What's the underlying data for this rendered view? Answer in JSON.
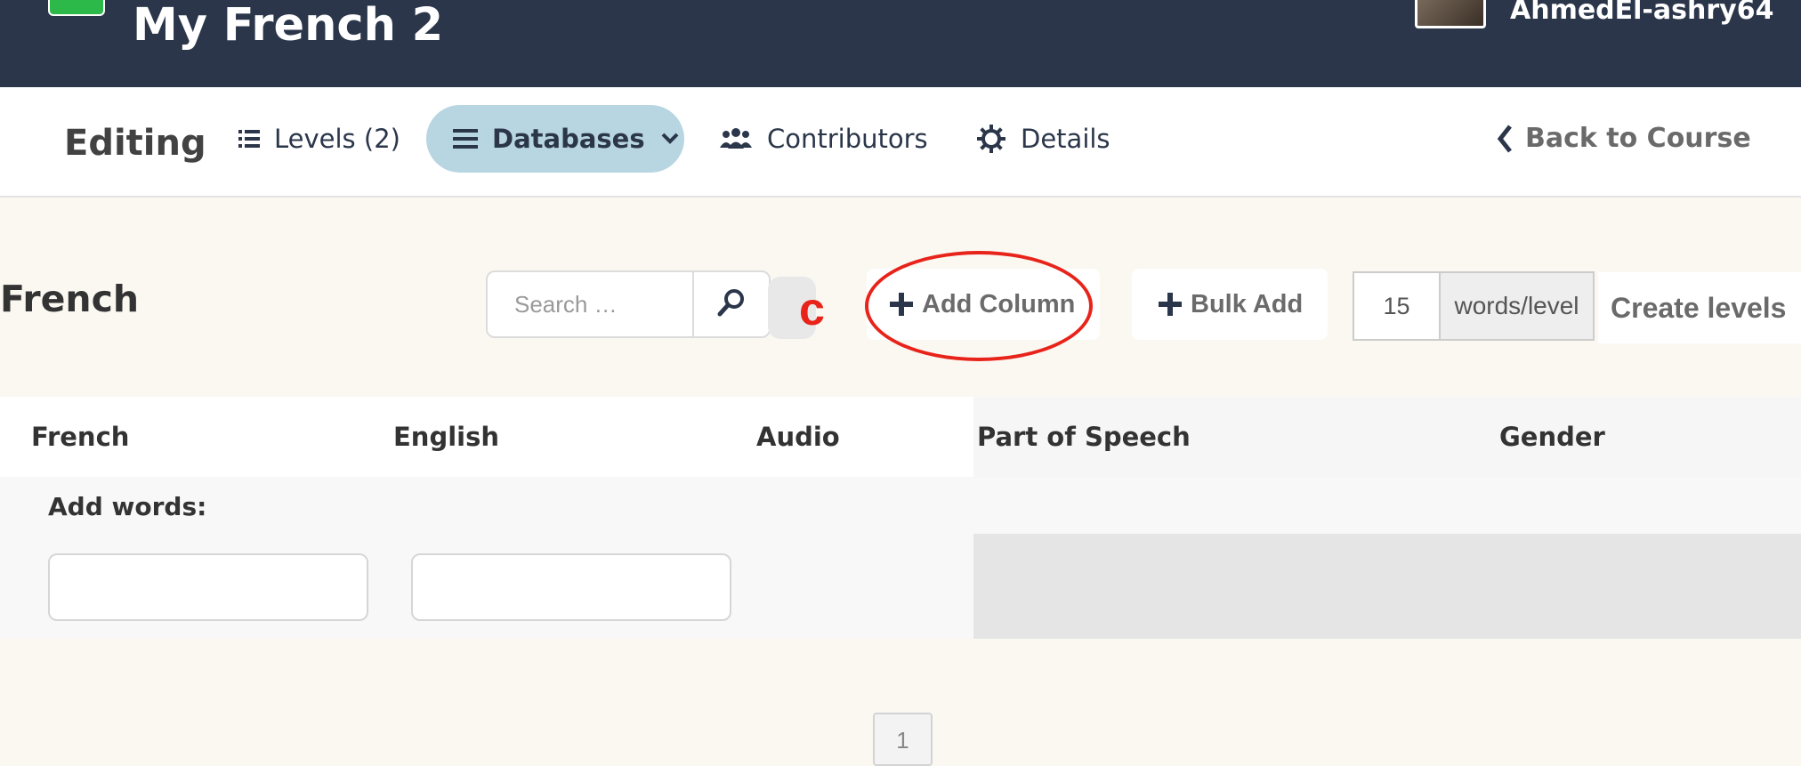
{
  "header": {
    "course_title": "My French 2",
    "username": "AhmedEl-ashry64"
  },
  "editbar": {
    "editing_label": "Editing",
    "nav": {
      "levels": "Levels (2)",
      "databases": "Databases",
      "contributors": "Contributors",
      "details": "Details"
    },
    "back_label": "Back to Course"
  },
  "database": {
    "title": "French",
    "search_placeholder": "Search …",
    "annotation_letter": "c",
    "add_column_label": "Add Column",
    "bulk_add_label": "Bulk Add",
    "words_per_level_value": "15",
    "words_per_level_suffix": "words/level",
    "create_levels_label": "Create levels"
  },
  "table": {
    "columns": [
      "French",
      "English",
      "Audio",
      "Part of Speech",
      "Gender"
    ],
    "add_words_label": "Add words:"
  },
  "pagination": {
    "current_page": "1"
  },
  "colors": {
    "header_bg": "#2b364a",
    "active_tab_bg": "#b8d6e1",
    "annotation_red": "#e8231a",
    "page_bg": "#fbf8f2"
  }
}
